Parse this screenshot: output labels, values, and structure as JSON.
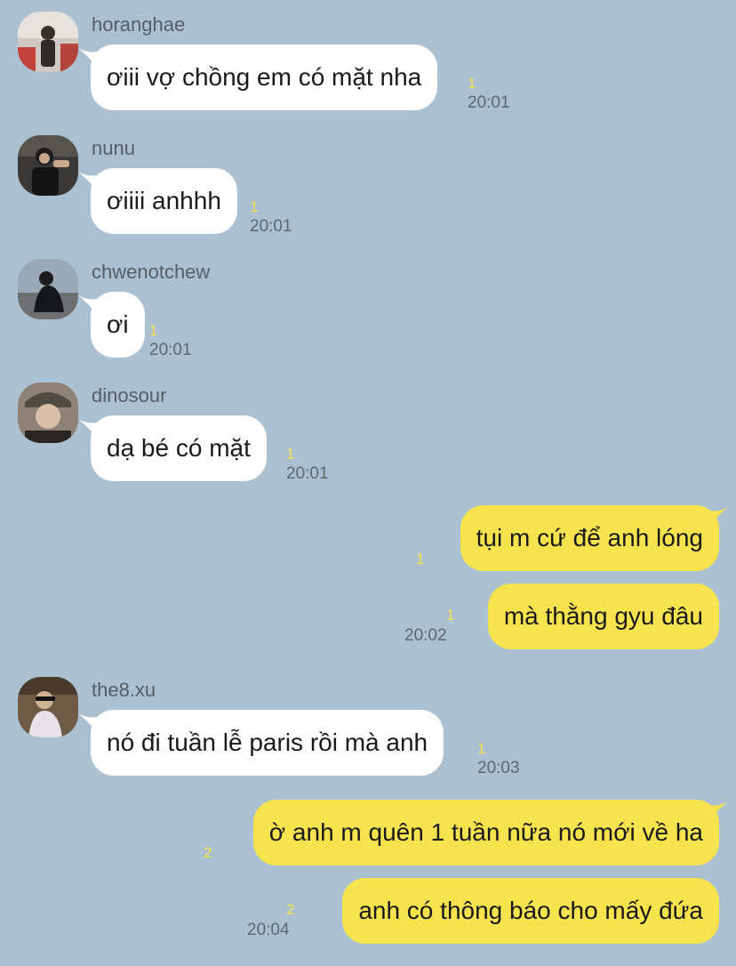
{
  "messages": [
    {
      "sender": "horanghae",
      "text": "ơiii vợ chồng em có mặt nha",
      "unread": "1",
      "time": "20:01"
    },
    {
      "sender": "nunu",
      "text": "ơiiii anhhh",
      "unread": "1",
      "time": "20:01"
    },
    {
      "sender": "chwenotchew",
      "text": "ơi",
      "unread": "1",
      "time": "20:01"
    },
    {
      "sender": "dinosour",
      "text": "dạ bé có mặt",
      "unread": "1",
      "time": "20:01"
    },
    {
      "sender": "me",
      "text": "tụi m cứ để anh lóng",
      "unread": "1",
      "time": ""
    },
    {
      "sender": "me",
      "text": "mà thằng gyu đâu",
      "unread": "1",
      "time": "20:02"
    },
    {
      "sender": "the8.xu",
      "text": "nó đi tuần lễ paris rồi mà anh",
      "unread": "1",
      "time": "20:03"
    },
    {
      "sender": "me",
      "text": "ờ anh m quên 1 tuần nữa nó mới về ha",
      "unread": "2",
      "time": ""
    },
    {
      "sender": "me",
      "text": "anh có thông báo cho mấy đứa",
      "unread": "2",
      "time": "20:04"
    }
  ],
  "colors": {
    "background": "#abc1d1",
    "incoming_bubble": "#ffffff",
    "outgoing_bubble": "#f7e34e",
    "unread": "#f7e34e"
  }
}
